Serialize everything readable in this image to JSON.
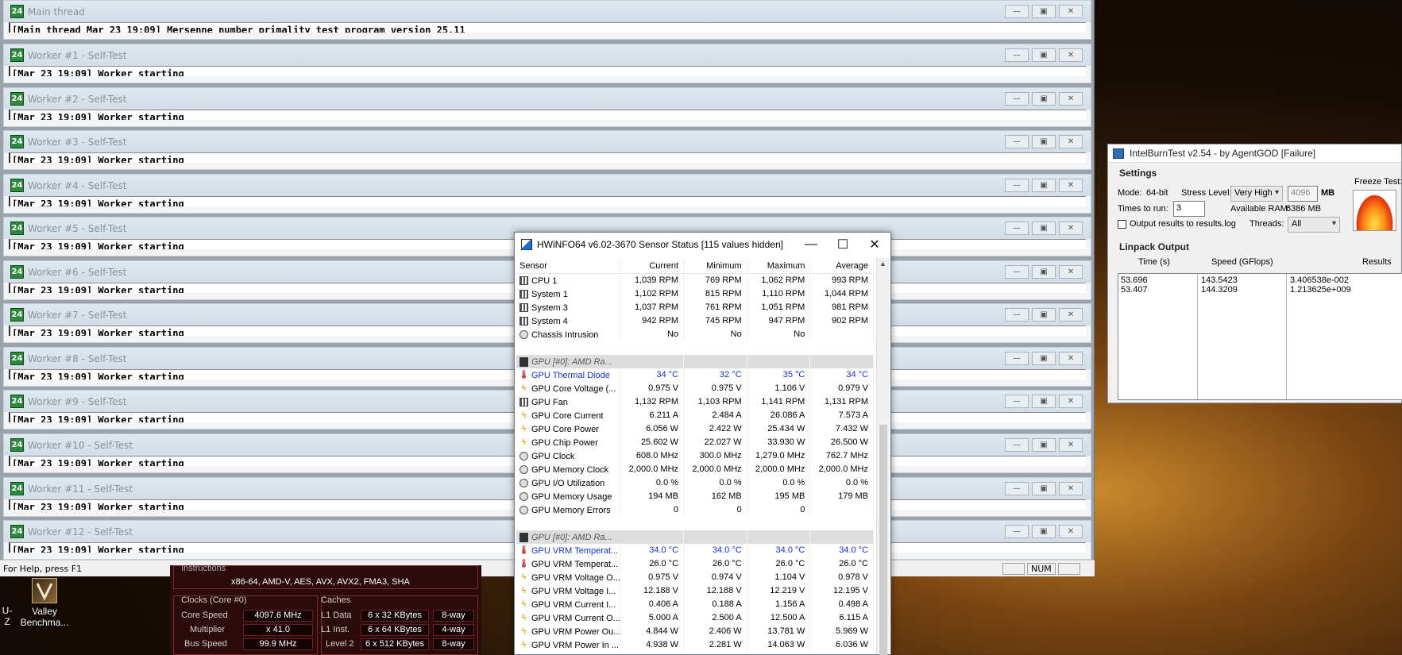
{
  "prime95": {
    "windows": [
      {
        "title": "Main thread",
        "line": "[Main thread Mar 23 19:09] Mersenne number primality test program version 25.11"
      },
      {
        "title": "Worker #1 - Self-Test",
        "line": "[Mar 23 19:09] Worker starting"
      },
      {
        "title": "Worker #2 - Self-Test",
        "line": "[Mar 23 19:09] Worker starting"
      },
      {
        "title": "Worker #3 - Self-Test",
        "line": "[Mar 23 19:09] Worker starting"
      },
      {
        "title": "Worker #4 - Self-Test",
        "line": "[Mar 23 19:09] Worker starting"
      },
      {
        "title": "Worker #5 - Self-Test",
        "line": "[Mar 23 19:09] Worker starting"
      },
      {
        "title": "Worker #6 - Self-Test",
        "line": "[Mar 23 19:09] Worker starting"
      },
      {
        "title": "Worker #7 - Self-Test",
        "line": "[Mar 23 19:09] Worker starting"
      },
      {
        "title": "Worker #8 - Self-Test",
        "line": "[Mar 23 19:09] Worker starting"
      },
      {
        "title": "Worker #9 - Self-Test",
        "line": "[Mar 23 19:09] Worker starting"
      },
      {
        "title": "Worker #10 - Self-Test",
        "line": "[Mar 23 19:09] Worker starting"
      },
      {
        "title": "Worker #11 - Self-Test",
        "line": "[Mar 23 19:09] Worker starting"
      },
      {
        "title": "Worker #12 - Self-Test",
        "line": "[Mar 23 19:09] Worker starting"
      }
    ],
    "button_glyphs": {
      "min": "—",
      "max": "▣",
      "close": "✕"
    },
    "status_help": "For Help, press F1",
    "status_num": "NUM"
  },
  "cpuz": {
    "instructions_label": "Instructions",
    "instructions_value": "x86-64, AMD-V, AES, AVX, AVX2, FMA3, SHA",
    "clocks_title": "Clocks (Core #0)",
    "core_speed_label": "Core Speed",
    "core_speed": "4097.6 MHz",
    "multiplier_label": "Multiplier",
    "multiplier": "x 41.0",
    "bus_speed_label": "Bus Speed",
    "bus_speed": "99.9 MHz",
    "caches_title": "Caches",
    "l1data_label": "L1 Data",
    "l1data": "6 x 32 KBytes",
    "l1data_way": "8-way",
    "l1inst_label": "L1 Inst.",
    "l1inst": "6 x 64 KBytes",
    "l1inst_way": "4-way",
    "level2_label": "Level 2",
    "level2": "6 x 512 KBytes",
    "level2_way": "8-way"
  },
  "desktop": {
    "left_label": "U-Z",
    "valley_label": "Valley Benchma..."
  },
  "hwinfo": {
    "title": "HWiNFO64 v6.02-3670 Sensor Status [115 values hidden]",
    "columns": [
      "Sensor",
      "Current",
      "Minimum",
      "Maximum",
      "Average"
    ],
    "rows": [
      {
        "type": "row",
        "icon": "fan",
        "name": "CPU 1",
        "cur": "1,039 RPM",
        "min": "769 RPM",
        "max": "1,062 RPM",
        "avg": "993 RPM"
      },
      {
        "type": "row",
        "icon": "fan",
        "name": "System 1",
        "cur": "1,102 RPM",
        "min": "815 RPM",
        "max": "1,110 RPM",
        "avg": "1,044 RPM"
      },
      {
        "type": "row",
        "icon": "fan",
        "name": "System 3",
        "cur": "1,037 RPM",
        "min": "761 RPM",
        "max": "1,051 RPM",
        "avg": "981 RPM"
      },
      {
        "type": "row",
        "icon": "fan",
        "name": "System 4",
        "cur": "942 RPM",
        "min": "745 RPM",
        "max": "947 RPM",
        "avg": "902 RPM"
      },
      {
        "type": "row",
        "icon": "gauge",
        "name": "Chassis Intrusion",
        "cur": "No",
        "min": "No",
        "max": "No",
        "avg": ""
      },
      {
        "type": "blank"
      },
      {
        "type": "group",
        "name": "GPU [#0]: AMD Ra..."
      },
      {
        "type": "row",
        "icon": "temp",
        "blue": true,
        "name": "GPU Thermal Diode",
        "cur": "34 °C",
        "min": "32 °C",
        "max": "35 °C",
        "avg": "34 °C"
      },
      {
        "type": "row",
        "icon": "volt",
        "name": "GPU Core Voltage (...",
        "cur": "0.975 V",
        "min": "0.975 V",
        "max": "1.106 V",
        "avg": "0.979 V"
      },
      {
        "type": "row",
        "icon": "fan",
        "name": "GPU Fan",
        "cur": "1,132 RPM",
        "min": "1,103 RPM",
        "max": "1,141 RPM",
        "avg": "1,131 RPM"
      },
      {
        "type": "row",
        "icon": "volt",
        "name": "GPU Core Current",
        "cur": "6.211 A",
        "min": "2.484 A",
        "max": "26.086 A",
        "avg": "7.573 A"
      },
      {
        "type": "row",
        "icon": "volt",
        "name": "GPU Core Power",
        "cur": "6.056 W",
        "min": "2.422 W",
        "max": "25.434 W",
        "avg": "7.432 W"
      },
      {
        "type": "row",
        "icon": "volt",
        "name": "GPU Chip Power",
        "cur": "25.602 W",
        "min": "22.027 W",
        "max": "33.930 W",
        "avg": "26.500 W"
      },
      {
        "type": "row",
        "icon": "gauge",
        "name": "GPU Clock",
        "cur": "608.0 MHz",
        "min": "300.0 MHz",
        "max": "1,279.0 MHz",
        "avg": "762.7 MHz"
      },
      {
        "type": "row",
        "icon": "gauge",
        "name": "GPU Memory Clock",
        "cur": "2,000.0 MHz",
        "min": "2,000.0 MHz",
        "max": "2,000.0 MHz",
        "avg": "2,000.0 MHz"
      },
      {
        "type": "row",
        "icon": "gauge",
        "name": "GPU I/O Utilization",
        "cur": "0.0 %",
        "min": "0.0 %",
        "max": "0.0 %",
        "avg": "0.0 %"
      },
      {
        "type": "row",
        "icon": "gauge",
        "name": "GPU Memory Usage",
        "cur": "194 MB",
        "min": "162 MB",
        "max": "195 MB",
        "avg": "179 MB"
      },
      {
        "type": "row",
        "icon": "gauge",
        "name": "GPU Memory Errors",
        "cur": "0",
        "min": "0",
        "max": "0",
        "avg": ""
      },
      {
        "type": "blank"
      },
      {
        "type": "group",
        "name": "GPU [#0]: AMD Ra..."
      },
      {
        "type": "row",
        "icon": "temp",
        "blue": true,
        "name": "GPU VRM Temperat...",
        "cur": "34.0 °C",
        "min": "34.0 °C",
        "max": "34.0 °C",
        "avg": "34.0 °C"
      },
      {
        "type": "row",
        "icon": "temp",
        "name": "GPU VRM Temperat...",
        "cur": "26.0 °C",
        "min": "26.0 °C",
        "max": "26.0 °C",
        "avg": "26.0 °C"
      },
      {
        "type": "row",
        "icon": "volt",
        "name": "GPU VRM Voltage O...",
        "cur": "0.975 V",
        "min": "0.974 V",
        "max": "1.104 V",
        "avg": "0.978 V"
      },
      {
        "type": "row",
        "icon": "volt",
        "name": "GPU VRM Voltage I...",
        "cur": "12.188 V",
        "min": "12.188 V",
        "max": "12.219 V",
        "avg": "12.195 V"
      },
      {
        "type": "row",
        "icon": "volt",
        "name": "GPU VRM Current I...",
        "cur": "0.406 A",
        "min": "0.188 A",
        "max": "1.156 A",
        "avg": "0.498 A"
      },
      {
        "type": "row",
        "icon": "volt",
        "name": "GPU VRM Current O...",
        "cur": "5.000 A",
        "min": "2.500 A",
        "max": "12.500 A",
        "avg": "6.115 A"
      },
      {
        "type": "row",
        "icon": "volt",
        "name": "GPU VRM Power Ou...",
        "cur": "4.844 W",
        "min": "2.406 W",
        "max": "13.781 W",
        "avg": "5.969 W"
      },
      {
        "type": "row",
        "icon": "volt",
        "name": "GPU VRM Power In ...",
        "cur": "4.938 W",
        "min": "2.281 W",
        "max": "14.063 W",
        "avg": "6.036 W"
      }
    ]
  },
  "ibt": {
    "title": "IntelBurnTest v2.54 - by AgentGOD [Failure]",
    "settings_heading": "Settings",
    "mode_label": "Mode:",
    "mode_value": "64-bit",
    "stress_label": "Stress Level:",
    "stress_value": "Very High",
    "mem_value": "4096",
    "mem_unit": "MB",
    "freeze_label": "Freeze Test:",
    "times_label": "Times to run:",
    "times_value": "3",
    "ram_label": "Available RAM:",
    "ram_value": "6386 MB",
    "output_check_label": "Output results to results.log",
    "threads_label": "Threads:",
    "threads_value": "All",
    "linpack_heading": "Linpack Output",
    "col_time": "Time (s)",
    "col_speed": "Speed (GFlops)",
    "col_results": "Results",
    "rows": [
      {
        "time": "53.696",
        "speed": "143.5423",
        "result": "3.406538e-002"
      },
      {
        "time": "53.407",
        "speed": "144.3209",
        "result": "1.213625e+009"
      }
    ]
  }
}
